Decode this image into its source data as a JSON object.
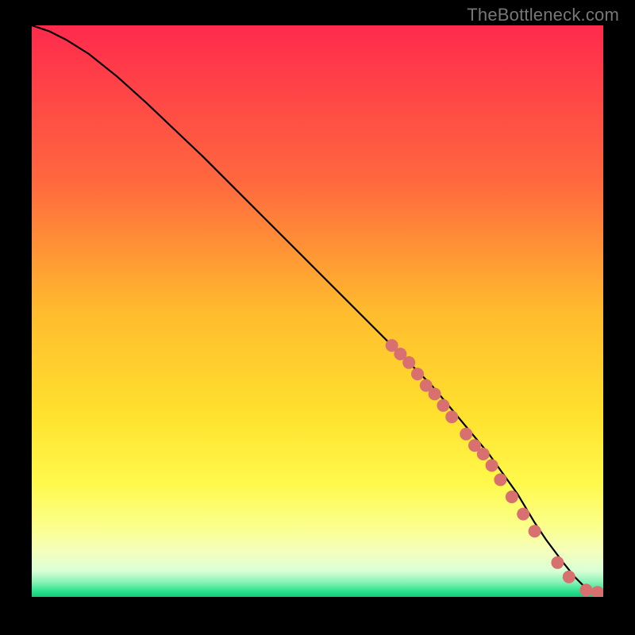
{
  "watermark": "TheBottleneck.com",
  "colors": {
    "gradient_stops": [
      {
        "offset": 0.0,
        "color": "#ff2a4d"
      },
      {
        "offset": 0.28,
        "color": "#ff6a3e"
      },
      {
        "offset": 0.5,
        "color": "#ffbb2e"
      },
      {
        "offset": 0.68,
        "color": "#ffe12e"
      },
      {
        "offset": 0.8,
        "color": "#fff94b"
      },
      {
        "offset": 0.88,
        "color": "#fbff8e"
      },
      {
        "offset": 0.92,
        "color": "#f4ffbc"
      },
      {
        "offset": 0.955,
        "color": "#d9ffd6"
      },
      {
        "offset": 0.975,
        "color": "#84f2b4"
      },
      {
        "offset": 0.99,
        "color": "#2ae28e"
      },
      {
        "offset": 1.0,
        "color": "#17c77a"
      }
    ],
    "curve": "#000000",
    "marker_fill": "#d97070",
    "marker_stroke": "#b85a5a"
  },
  "chart_data": {
    "type": "line",
    "title": "",
    "xlabel": "",
    "ylabel": "",
    "xlim": [
      0,
      100
    ],
    "ylim": [
      0,
      100
    ],
    "series": [
      {
        "name": "bottleneck-curve",
        "x": [
          0,
          3,
          6,
          10,
          15,
          20,
          30,
          40,
          50,
          60,
          70,
          80,
          85,
          88,
          90,
          93,
          95,
          97,
          99,
          100
        ],
        "y": [
          100,
          99,
          97.5,
          95,
          91,
          86.5,
          77,
          67,
          57,
          47,
          37,
          25,
          18,
          13,
          10,
          6,
          3.5,
          1.5,
          0.5,
          0.5
        ]
      }
    ],
    "markers": {
      "name": "highlighted-range",
      "x": [
        63,
        64.5,
        66,
        67.5,
        69,
        70.5,
        72,
        73.5,
        76,
        77.5,
        79,
        80.5,
        82,
        84,
        86,
        88,
        92,
        94,
        97,
        99
      ],
      "y": [
        44,
        42.5,
        41,
        39,
        37,
        35.5,
        33.5,
        31.5,
        28.5,
        26.5,
        25,
        23,
        20.5,
        17.5,
        14.5,
        11.5,
        6,
        3.5,
        1.2,
        0.8
      ]
    }
  }
}
